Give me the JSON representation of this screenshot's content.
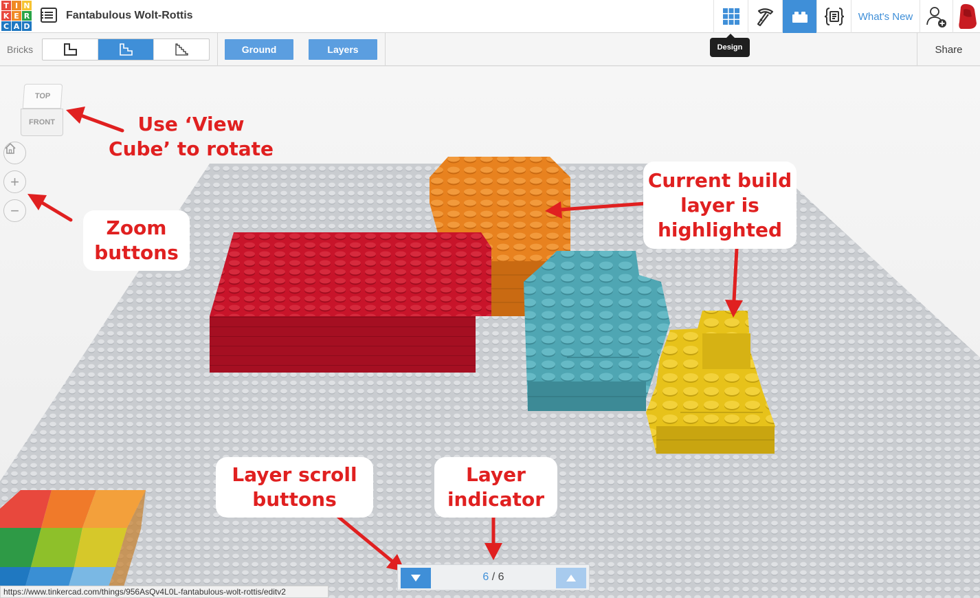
{
  "app": {
    "logo_letters": [
      "T",
      "I",
      "N",
      "K",
      "E",
      "R",
      "C",
      "A",
      "D"
    ],
    "logo_colors": [
      "#e8483d",
      "#f08a24",
      "#f6c331",
      "#e8483d",
      "#f08a24",
      "#27a346",
      "#1f78c1",
      "#1f78c1",
      "#1f78c1"
    ],
    "design_title": "Fantabulous Wolt-Rottis"
  },
  "header": {
    "buttons": [
      {
        "name": "design-grid",
        "icon": "grid-icon",
        "active": false
      },
      {
        "name": "pickaxe",
        "icon": "pickaxe-icon",
        "active": false
      },
      {
        "name": "bricks",
        "icon": "brick-icon",
        "active": true
      },
      {
        "name": "codeblocks",
        "icon": "code-braces-icon",
        "active": false
      }
    ],
    "whats_new": "What's New",
    "tooltip": "Design"
  },
  "toolbar": {
    "bricks_label": "Bricks",
    "brick_modes": [
      "brick-mode-1",
      "brick-mode-2",
      "brick-mode-3"
    ],
    "active_mode": 1,
    "ground_label": "Ground",
    "layers_label": "Layers",
    "share_label": "Share"
  },
  "viewport": {
    "viewcube": {
      "top": "TOP",
      "front": "FRONT"
    },
    "nav": {
      "home": "home-icon",
      "zoom_in": "+",
      "zoom_out": "−"
    },
    "brick_colors": {
      "red": "#c8142a",
      "orange": "#e8821f",
      "teal": "#4fa6b3",
      "yellow": "#e7c21a",
      "baseplate": "#c9ccd0"
    }
  },
  "annotations": {
    "view_cube": [
      "Use ‘View",
      "Cube’ to rotate"
    ],
    "zoom": [
      "Zoom",
      "buttons"
    ],
    "current_layer": [
      "Current build",
      "layer is",
      "highlighted"
    ],
    "scroll": [
      "Layer scroll",
      "buttons"
    ],
    "indicator": [
      "Layer",
      "indicator"
    ],
    "color": "#e02020"
  },
  "layer_bar": {
    "current": "6",
    "separator": "/",
    "total": "6"
  },
  "status_url": "https://www.tinkercad.com/things/956AsQv4L0L-fantabulous-wolt-rottis/editv2"
}
